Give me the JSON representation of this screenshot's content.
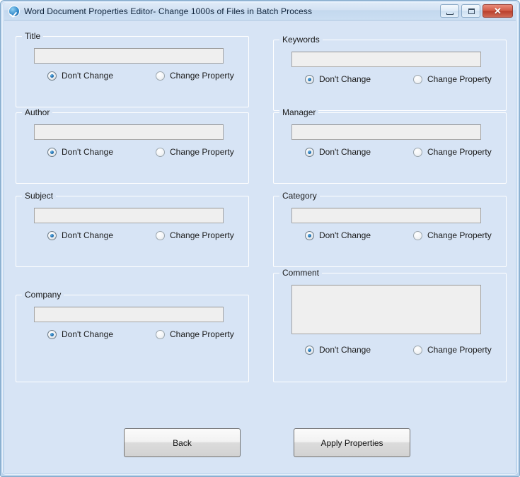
{
  "window": {
    "title": "Word Document Properties Editor- Change 1000s of Files in Batch Process",
    "icon": "app-check-circle-icon",
    "controls": {
      "minimize": "minimize-icon",
      "maximize": "maximize-icon",
      "close": "✕"
    }
  },
  "radio_labels": {
    "dont_change": "Don't Change",
    "change_property": "Change Property"
  },
  "groups": [
    {
      "key": "title",
      "label": "Title",
      "value": "",
      "placeholder": "",
      "selected": "dont_change",
      "field": "input"
    },
    {
      "key": "keywords",
      "label": "Keywords",
      "value": "",
      "placeholder": "",
      "selected": "dont_change",
      "field": "input"
    },
    {
      "key": "author",
      "label": "Author",
      "value": "",
      "placeholder": "",
      "selected": "dont_change",
      "field": "input"
    },
    {
      "key": "manager",
      "label": "Manager",
      "value": "",
      "placeholder": "",
      "selected": "dont_change",
      "field": "input"
    },
    {
      "key": "subject",
      "label": "Subject",
      "value": "",
      "placeholder": "",
      "selected": "dont_change",
      "field": "input"
    },
    {
      "key": "category",
      "label": "Category",
      "value": "",
      "placeholder": "",
      "selected": "dont_change",
      "field": "input"
    },
    {
      "key": "company",
      "label": "Company",
      "value": "",
      "placeholder": "",
      "selected": "dont_change",
      "field": "input"
    },
    {
      "key": "comment",
      "label": "Comment",
      "value": "",
      "placeholder": "",
      "selected": "dont_change",
      "field": "textarea"
    }
  ],
  "footer": {
    "back_label": "Back",
    "apply_label": "Apply Properties"
  },
  "colors": {
    "client_background": "#d7e4f5",
    "titlebar": "#d3e2f3",
    "frame_border": "#7ea7c9",
    "group_border": "#ffffff",
    "textbox_fill": "#efefef",
    "textbox_border": "#a4a4a4",
    "radio_accent": "#1c6fb0",
    "close_button": "#c0452f",
    "text": "#1b1b1b"
  }
}
